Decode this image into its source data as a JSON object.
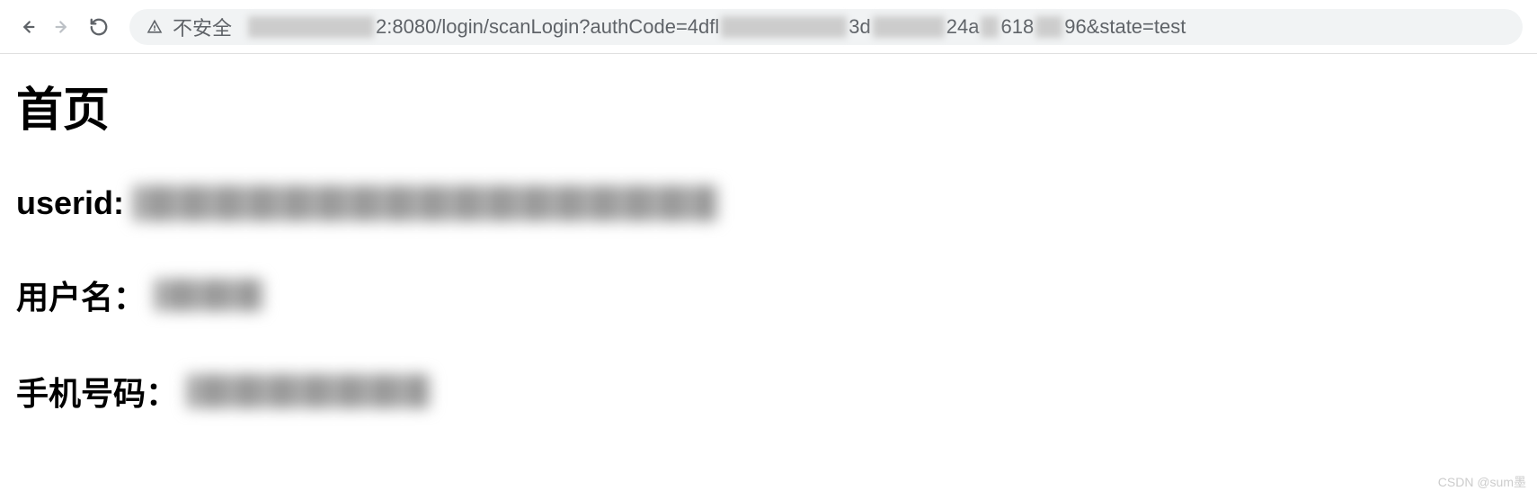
{
  "browser": {
    "security_label": "不安全",
    "url_visible_parts": {
      "seg1": "2:8080/login/scanLogin?authCode=4dfl",
      "seg2": "3d",
      "seg3": "24a",
      "seg4": "618",
      "seg5": "96&state=test"
    }
  },
  "page": {
    "title": "首页",
    "fields": {
      "userid_label": "userid:",
      "username_label": "用户名：",
      "phone_label": "手机号码："
    }
  },
  "watermark": "CSDN @sum墨"
}
